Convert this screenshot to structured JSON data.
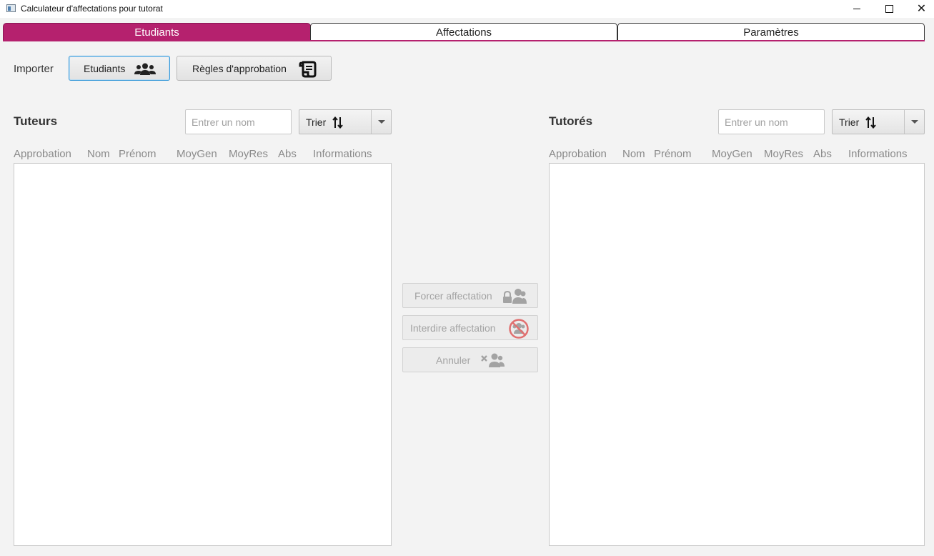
{
  "window": {
    "title": "Calculateur d'affectations pour tutorat",
    "controls": [
      "minimize",
      "maximize",
      "close"
    ]
  },
  "tabs": [
    {
      "label": "Etudiants",
      "active": true
    },
    {
      "label": "Affectations",
      "active": false
    },
    {
      "label": "Paramètres",
      "active": false
    }
  ],
  "colors": {
    "accent": "#b5216e",
    "focus": "#3a9ad9",
    "forbid_icon": "#e07070"
  },
  "import": {
    "label": "Importer",
    "students_button": "Etudiants",
    "students_icon": "users-icon",
    "rules_button": "Règles d'approbation",
    "rules_icon": "scroll-icon"
  },
  "tutors": {
    "title": "Tuteurs",
    "search_placeholder": "Entrer un nom",
    "sort_label": "Trier",
    "columns": [
      "Approbation",
      "Nom",
      "Prénom",
      "MoyGen",
      "MoyRes",
      "Abs",
      "Informations"
    ],
    "rows": []
  },
  "tutored": {
    "title": "Tutorés",
    "search_placeholder": "Entrer un nom",
    "sort_label": "Trier",
    "columns": [
      "Approbation",
      "Nom",
      "Prénom",
      "MoyGen",
      "MoyRes",
      "Abs",
      "Informations"
    ],
    "rows": []
  },
  "actions": {
    "force": {
      "label": "Forcer affectation",
      "icon": "users-lock-icon",
      "enabled": false
    },
    "forbid": {
      "label": "Interdire affectation",
      "icon": "users-forbidden-icon",
      "enabled": false
    },
    "cancel": {
      "label": "Annuler",
      "icon": "users-remove-icon",
      "enabled": false
    }
  }
}
